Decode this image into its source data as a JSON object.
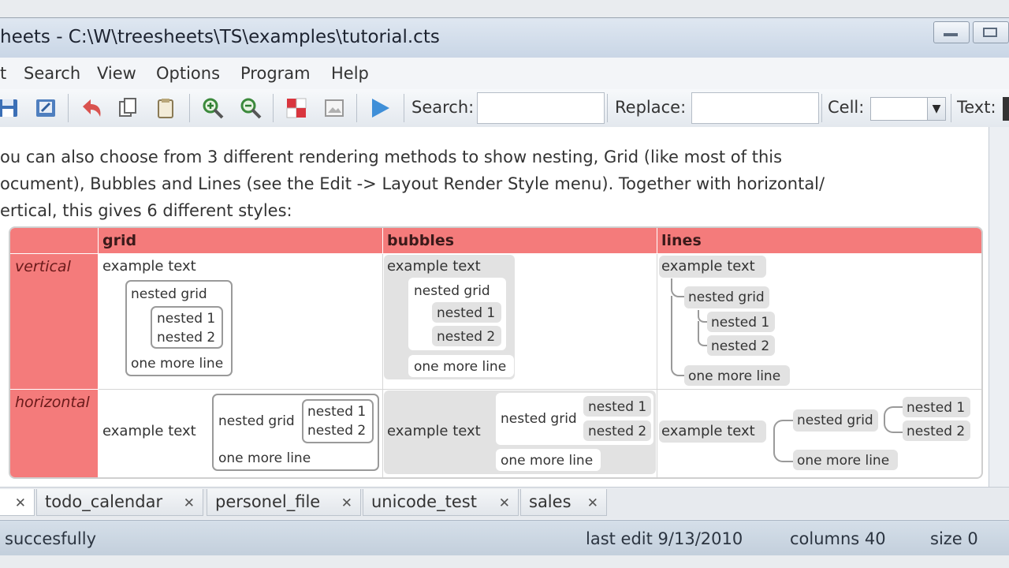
{
  "window": {
    "title": "heets - C:\\W\\treesheets\\TS\\examples\\tutorial.cts"
  },
  "menu": [
    "t",
    "Search",
    "View",
    "Options",
    "Program",
    "Help"
  ],
  "toolbar": {
    "search_label": "Search:",
    "search_value": "",
    "replace_label": "Replace:",
    "replace_value": "",
    "cell_label": "Cell:",
    "cell_value": "",
    "text_label": "Text:"
  },
  "document": {
    "intro_lines": [
      "ou can also choose from 3 different rendering methods to show nesting, Grid (like most of this",
      "ocument), Bubbles and Lines (see the Edit -> Layout Render Style menu). Together with horizontal/",
      "ertical, this gives 6 different styles:"
    ],
    "col_headers": [
      "grid",
      "bubbles",
      "lines"
    ],
    "row_headers": [
      "vertical",
      "horizontal"
    ],
    "example_text": "example text",
    "nested_grid": "nested grid",
    "nested_1": "nested 1",
    "nested_2": "nested 2",
    "one_more_line": "one more line"
  },
  "tabs": [
    {
      "label": ""
    },
    {
      "label": "todo_calendar"
    },
    {
      "label": "personel_file"
    },
    {
      "label": "unicode_test"
    },
    {
      "label": "sales"
    }
  ],
  "status": {
    "message": "succesfully",
    "last_edit": "last edit 9/13/2010",
    "columns": "columns 40",
    "size": "size 0"
  },
  "colors": {
    "header_red": "#f47b7b",
    "bubble_gray": "#e2e2e2"
  }
}
